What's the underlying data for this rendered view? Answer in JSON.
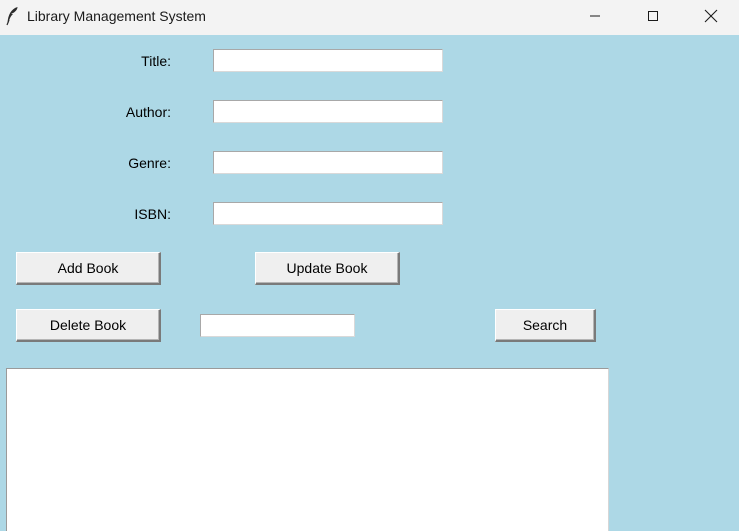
{
  "window": {
    "title": "Library Management System",
    "background_color": "#add8e6",
    "icon": "feather-icon",
    "controls": {
      "minimize": "minimize-icon",
      "maximize": "maximize-icon",
      "close": "close-icon"
    }
  },
  "form": {
    "title_label": "Title:",
    "title_value": "",
    "author_label": "Author:",
    "author_value": "",
    "genre_label": "Genre:",
    "genre_value": "",
    "isbn_label": "ISBN:",
    "isbn_value": ""
  },
  "buttons": {
    "add": "Add Book",
    "update": "Update Book",
    "delete": "Delete Book",
    "search": "Search"
  },
  "search": {
    "value": ""
  },
  "book_list": {
    "items": []
  }
}
